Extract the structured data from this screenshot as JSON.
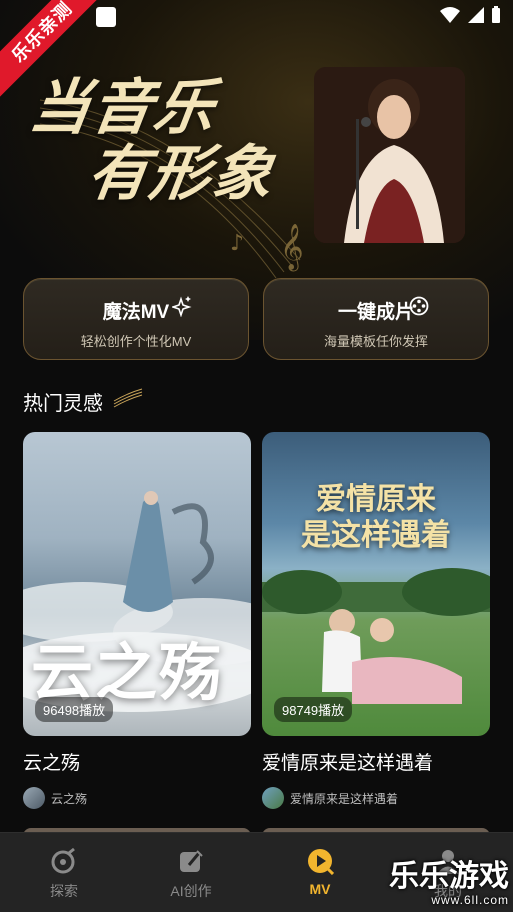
{
  "ribbon": {
    "text": "乐乐亲测"
  },
  "hero": {
    "headline_line1": "当音乐",
    "headline_line2": "有形象"
  },
  "actions": [
    {
      "title": "魔法MV",
      "subtitle": "轻松创作个性化MV",
      "icon": "sparkle-icon"
    },
    {
      "title": "一键成片",
      "subtitle": "海量模板任你发挥",
      "icon": "film-reel-icon"
    }
  ],
  "section": {
    "title": "热门灵感"
  },
  "feed": [
    {
      "thumb_title": "云之殇",
      "play_count": "96498播放",
      "name": "云之殇",
      "author": "云之殇"
    },
    {
      "thumb_title": "爱情原来是这样遇着",
      "thumb_title_line1": "爱情原来",
      "thumb_title_line2": "是这样遇着",
      "play_count": "98749播放",
      "name": "爱情原来是这样遇着",
      "author": "爱情原来是这样遇着"
    }
  ],
  "nav": {
    "items": [
      {
        "label": "探索",
        "icon": "explore-icon",
        "active": false
      },
      {
        "label": "AI创作",
        "icon": "ai-create-icon",
        "active": false
      },
      {
        "label": "MV",
        "icon": "mv-play-icon",
        "active": true
      },
      {
        "label": "我的",
        "icon": "profile-icon",
        "active": false
      }
    ]
  },
  "colors": {
    "accent": "#f2b52e",
    "card_border": "#6b5430",
    "ribbon": "#e0192b"
  },
  "watermark": {
    "brand": "乐乐游戏",
    "url": "www.6ll.com"
  }
}
